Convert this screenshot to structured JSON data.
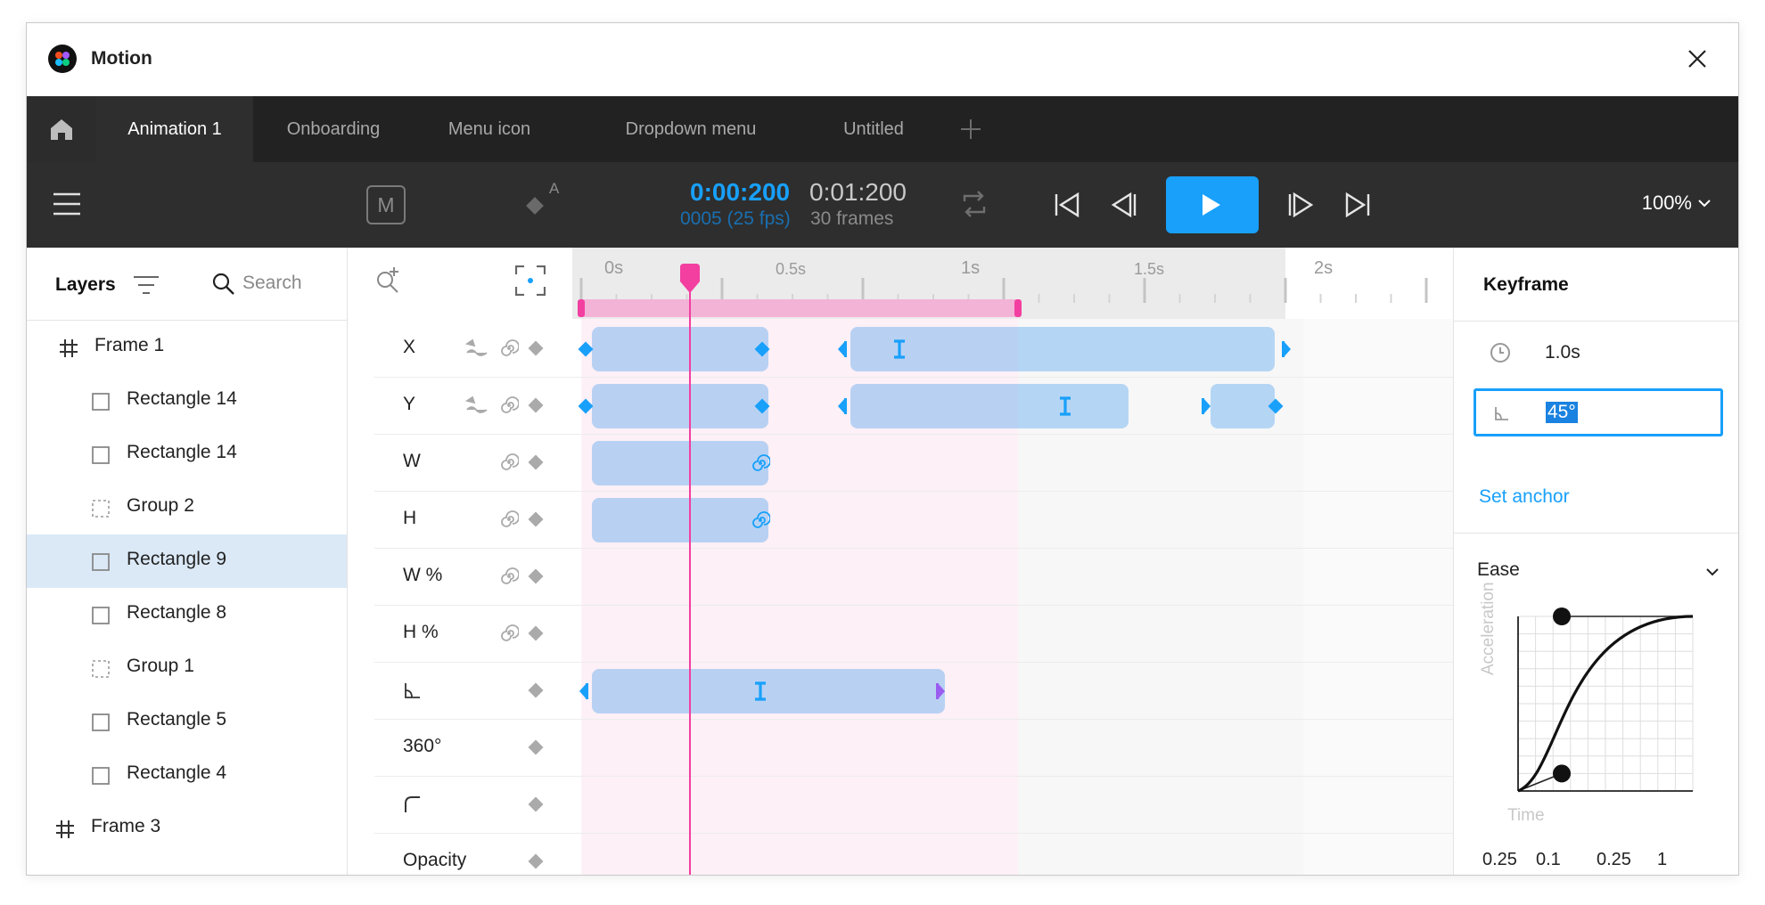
{
  "window": {
    "title": "Motion"
  },
  "tabs": [
    {
      "label": "Animation 1",
      "active": true
    },
    {
      "label": "Onboarding"
    },
    {
      "label": "Menu icon"
    },
    {
      "label": "Dropdown menu"
    },
    {
      "label": "Untitled"
    }
  ],
  "toolbar": {
    "mode_label": "M",
    "auto_label": "A",
    "time_current": "0:00:200",
    "time_total": "0:01:200",
    "fps": "0005 (25 fps)",
    "frames": "30 frames",
    "zoom": "100%"
  },
  "layers": {
    "title": "Layers",
    "search_placeholder": "Search",
    "items": [
      {
        "label": "Frame 1",
        "type": "frame"
      },
      {
        "label": "Rectangle 14",
        "type": "rect"
      },
      {
        "label": "Rectangle 14",
        "type": "rect"
      },
      {
        "label": "Group 2",
        "type": "group"
      },
      {
        "label": "Rectangle 9",
        "type": "rect",
        "selected": true
      },
      {
        "label": "Rectangle 8",
        "type": "rect"
      },
      {
        "label": "Group 1",
        "type": "group"
      },
      {
        "label": "Rectangle 5",
        "type": "rect"
      },
      {
        "label": "Rectangle 4",
        "type": "rect"
      },
      {
        "label": "Frame 3",
        "type": "frame"
      }
    ]
  },
  "timeline": {
    "ruler": [
      "0s",
      "0.5s",
      "1s",
      "1.5s",
      "2s"
    ],
    "properties": [
      "X",
      "Y",
      "W",
      "H",
      "W %",
      "H %",
      "",
      "360°",
      "",
      "Opacity"
    ],
    "colors": {
      "keyframe": "#18a0fb",
      "playhead": "#f23fa0",
      "accent_end": "#9b5cf0"
    }
  },
  "inspector": {
    "title": "Keyframe",
    "time": "1.0s",
    "angle": "45°",
    "set_anchor": "Set anchor",
    "ease_label": "Ease",
    "axis_y": "Acceleration",
    "axis_x": "Time",
    "bezier": [
      "0.25",
      "0.1",
      "0.25",
      "1"
    ]
  }
}
